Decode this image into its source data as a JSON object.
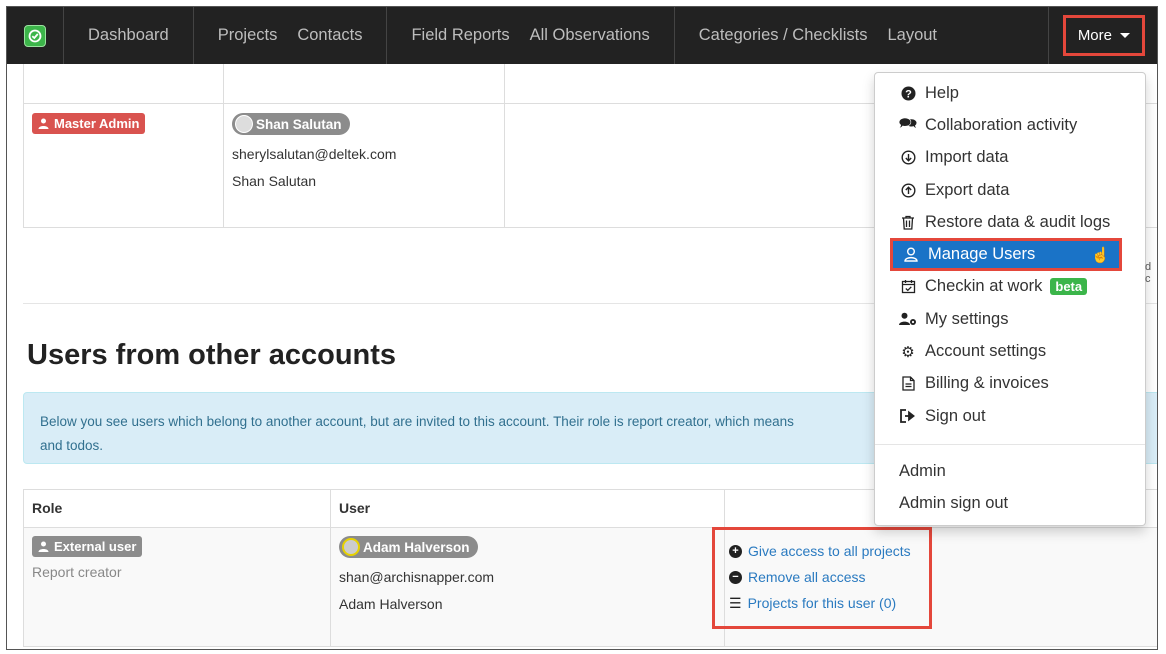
{
  "navbar": {
    "links": [
      "Dashboard",
      "Projects",
      "Contacts",
      "Field Reports",
      "All Observations",
      "Categories / Checklists",
      "Layout"
    ],
    "more_label": "More"
  },
  "top_table": {
    "role_label": "Master Admin",
    "user_pill": "Shan Salutan",
    "email": "sherylsalutan@deltek.com",
    "full_name": "Shan Salutan"
  },
  "section": {
    "heading": "Users from other accounts",
    "info_text": "Below you see users which belong to another account, but are invited to this account. Their role is report creator, which means",
    "info_text_2": "and todos."
  },
  "bottom_table": {
    "headers": [
      "Role",
      "User"
    ],
    "role_label": "External user",
    "role_sub": "Report creator",
    "user_pill": "Adam Halverson",
    "email": "shan@archisnapper.com",
    "full_name": "Adam Halverson",
    "actions": {
      "give_access": "Give access to all projects",
      "remove_access": "Remove all access",
      "projects_for_user": "Projects for this user (0)"
    }
  },
  "dropdown": {
    "items": [
      "Help",
      "Collaboration activity",
      "Import data",
      "Export data",
      "Restore data & audit logs",
      "Manage Users",
      "Checkin at work",
      "My settings",
      "Account settings",
      "Billing & invoices",
      "Sign out"
    ],
    "beta_badge": "beta",
    "admin_items": [
      "Admin",
      "Admin sign out"
    ]
  },
  "side_chip": "d c"
}
